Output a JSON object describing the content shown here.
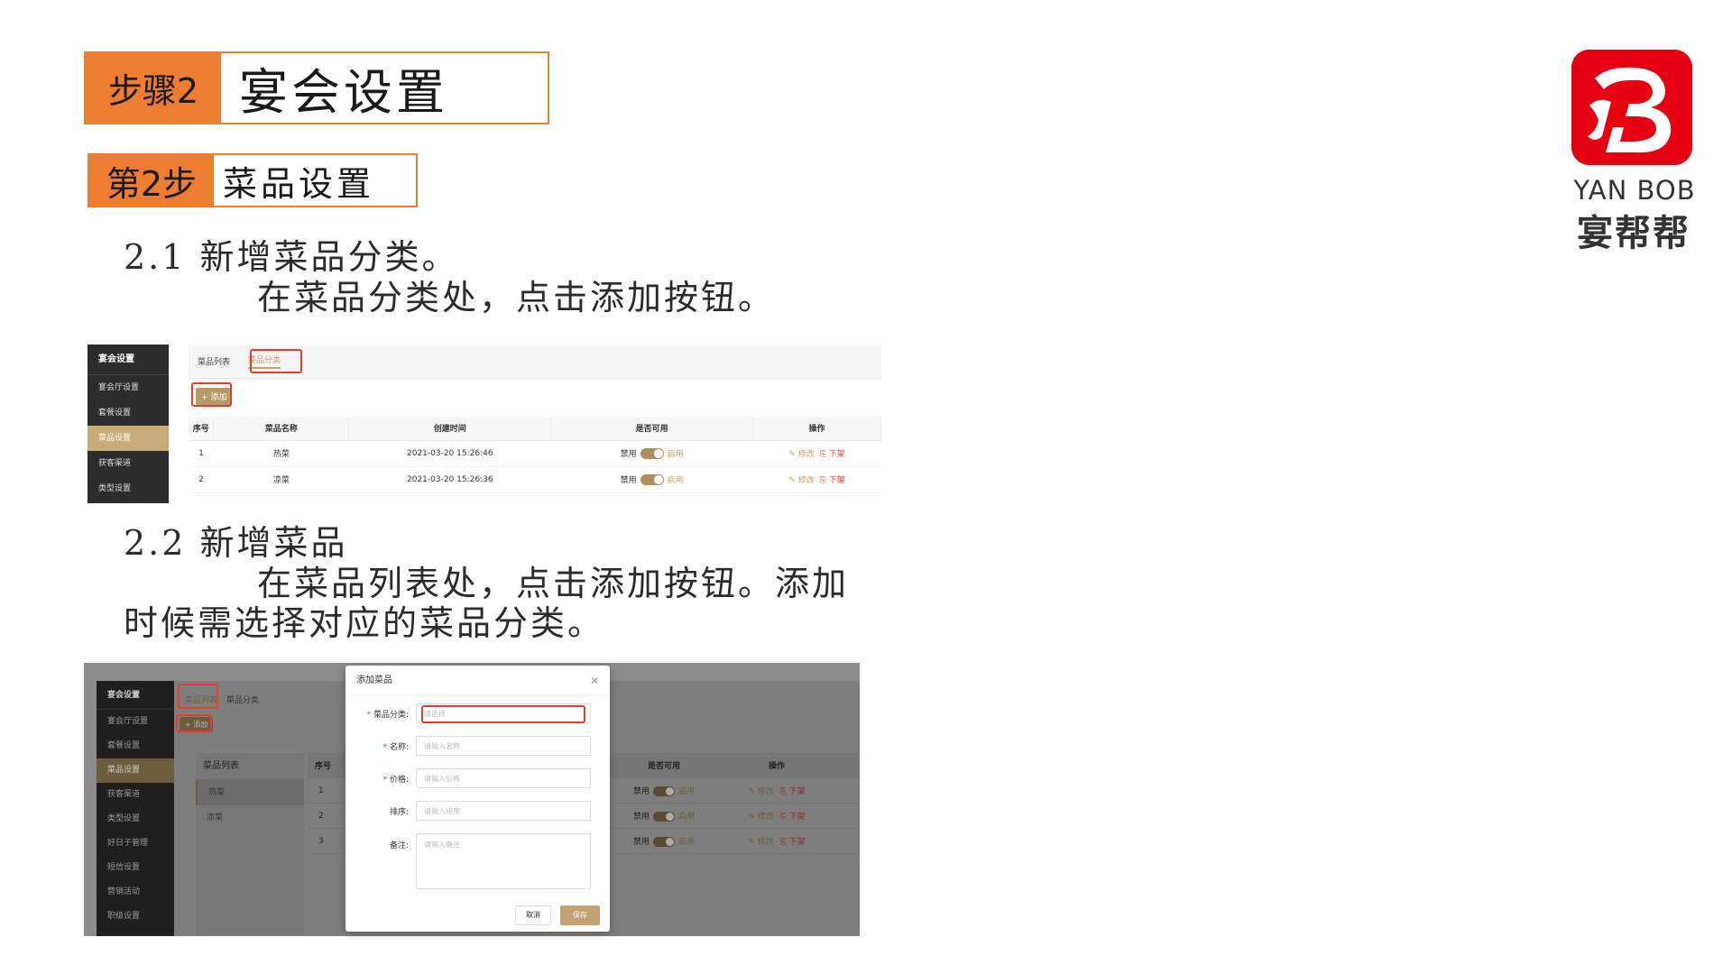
{
  "step": {
    "label": "步骤2",
    "title": "宴会设置"
  },
  "substep": {
    "label": "第2步",
    "title": "菜品设置"
  },
  "section1": {
    "heading": "2.1  新增菜品分类。",
    "desc": "在菜品分类处，点击添加按钮。"
  },
  "section2": {
    "heading": "2.2  新增菜品",
    "desc_line1": "在菜品列表处，点击添加按钮。添加",
    "desc_line2": "时候需选择对应的菜品分类。"
  },
  "logo": {
    "text_en": "YAN BOB",
    "text_cn": "宴帮帮",
    "color": "#e60012"
  },
  "shot1": {
    "sidebar": {
      "title": "宴会设置",
      "items": [
        "宴会厅设置",
        "套餐设置",
        "菜品设置",
        "获客渠道",
        "类型设置"
      ],
      "active_index": 2
    },
    "tabs": [
      "菜品列表",
      "菜品分类"
    ],
    "active_tab": "菜品分类",
    "add_button": "+ 添加",
    "columns": [
      "序号",
      "菜品名称",
      "创建时间",
      "是否可用",
      "操作"
    ],
    "rows": [
      {
        "index": "1",
        "name": "热菜",
        "created": "2021-03-20 15:26:46",
        "off": "禁用",
        "on": "启用",
        "edit": "修改",
        "delist": "下架"
      },
      {
        "index": "2",
        "name": "凉菜",
        "created": "2021-03-20 15:26:36",
        "off": "禁用",
        "on": "启用",
        "edit": "修改",
        "delist": "下架"
      }
    ]
  },
  "shot2": {
    "sidebar": {
      "title": "宴会设置",
      "items": [
        "宴会厅设置",
        "套餐设置",
        "菜品设置",
        "获客渠道",
        "类型设置",
        "好日子管理",
        "短信设置",
        "营销活动",
        "职级设置"
      ],
      "active_index": 2
    },
    "tabs": [
      "菜品列表",
      "菜品分类"
    ],
    "add_button": "+ 添加",
    "category_list": {
      "title": "菜品列表",
      "items": [
        "热菜",
        "凉菜"
      ]
    },
    "columns": [
      "序号",
      "是否可用",
      "操作"
    ],
    "rows": [
      {
        "index": "1",
        "off": "禁用",
        "on": "启用",
        "edit": "修改",
        "delist": "下架"
      },
      {
        "index": "2",
        "off": "禁用",
        "on": "启用",
        "edit": "修改",
        "delist": "下架"
      },
      {
        "index": "3",
        "off": "禁用",
        "on": "启用",
        "edit": "修改",
        "delist": "下架"
      }
    ],
    "modal": {
      "title": "添加菜品",
      "fields": [
        {
          "label": "菜品分类:",
          "required": true,
          "placeholder": "请选择"
        },
        {
          "label": "名称:",
          "required": true,
          "placeholder": "请输入名称"
        },
        {
          "label": "价格:",
          "required": true,
          "placeholder": "请输入价格"
        },
        {
          "label": "排序:",
          "required": false,
          "placeholder": "请输入排序"
        },
        {
          "label": "备注:",
          "required": false,
          "placeholder": "请输入备注"
        }
      ],
      "cancel": "取消",
      "save": "保存"
    }
  }
}
